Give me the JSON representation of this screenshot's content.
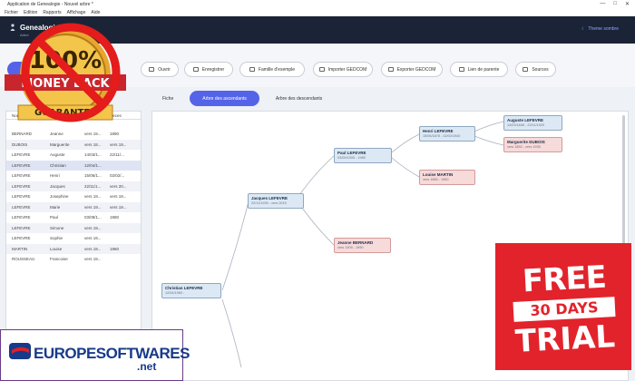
{
  "window": {
    "title": "Application de Genealogie - Nouvel arbre *",
    "controls": [
      "—",
      "□",
      "✕"
    ]
  },
  "menu": [
    "Fichier",
    "Edition",
    "Rapports",
    "Affichage",
    "Aide"
  ],
  "header": {
    "app_name": "Genealogie",
    "subtitle": "Arbre",
    "theme_label": "Theme sombre"
  },
  "toolbar": {
    "buttons": [
      "Ouvrir",
      "Enregistrer",
      "Famille d'exemple",
      "Importer GEDCOM",
      "Exporter GEDCOM",
      "Lien de parente",
      "Sources"
    ]
  },
  "tabs": {
    "items": [
      "Fiche",
      "Arbre des ascendants",
      "Arbre des descendants"
    ],
    "active_index": 1
  },
  "people_table": {
    "headers": [
      "Nom",
      "Prenom",
      "Naissance",
      "Deces"
    ],
    "rows": [
      [
        "BERNARD",
        "Jeanne",
        "vers 19...",
        "1990"
      ],
      [
        "DUBOIS",
        "Marguerite",
        "vers 18...",
        "vers 19..."
      ],
      [
        "LEFEVRE",
        "Auguste",
        "14/03/1...",
        "22/11/..."
      ],
      [
        "LEFEVRE",
        "Christian",
        "12/04/1...",
        ""
      ],
      [
        "LEFEVRE",
        "Henri",
        "15/06/1...",
        "02/02/..."
      ],
      [
        "LEFEVRE",
        "Jacques",
        "22/11/1...",
        "vers 20..."
      ],
      [
        "LEFEVRE",
        "Josephine",
        "vers 19...",
        "vers 19..."
      ],
      [
        "LEFEVRE",
        "Marie",
        "vers 19...",
        "vers 19..."
      ],
      [
        "LEFEVRE",
        "Paul",
        "03/09/1...",
        "1980"
      ],
      [
        "LEFEVRE",
        "Simone",
        "vers 19...",
        ""
      ],
      [
        "LEFEVRE",
        "Sophie",
        "vers 19...",
        ""
      ],
      [
        "MARTIN",
        "Louise",
        "vers 19...",
        "1960"
      ],
      [
        "ROUSSEAU",
        "Francoise",
        "vers 19...",
        ""
      ]
    ],
    "selected_index": 3
  },
  "tree_nodes": {
    "christian": {
      "name": "Christian LEFEVRE",
      "dates": "12/04/1960 -"
    },
    "jacques": {
      "name": "Jacques LEFEVRE",
      "dates": "22/11/1930 - vers 2015"
    },
    "paul": {
      "name": "Paul LEFEVRE",
      "dates": "03/09/1905 - 1980"
    },
    "jeanne": {
      "name": "Jeanne BERNARD",
      "dates": "vers 1909 - 1990"
    },
    "henri": {
      "name": "Henri LEFEVRE",
      "dates": "15/06/1878 - 02/02/1940"
    },
    "louise": {
      "name": "Louise MARTIN",
      "dates": "vers 1880 - 1960"
    },
    "auguste": {
      "name": "Auguste LEFEVRE",
      "dates": "14/03/1848 - 22/11/1920"
    },
    "marguerite": {
      "name": "Marguerite DUBOIS",
      "dates": "vers 1852 - vers 1935"
    }
  },
  "overlays": {
    "badge_top": "100%",
    "badge_mid": "MONEY BACK",
    "badge_bottom": "GUARANTEE",
    "trial_free": "FREE",
    "trial_days": "30 DAYS",
    "trial_trial": "TRIAL",
    "logo_name": "EUROPESOFTWARES",
    "logo_net": ".net"
  },
  "colors": {
    "accent": "#5563e8",
    "header_bg": "#1b2436",
    "male_node": "#dce9f5",
    "female_node": "#f7dada",
    "badge_red": "#e2232b"
  }
}
